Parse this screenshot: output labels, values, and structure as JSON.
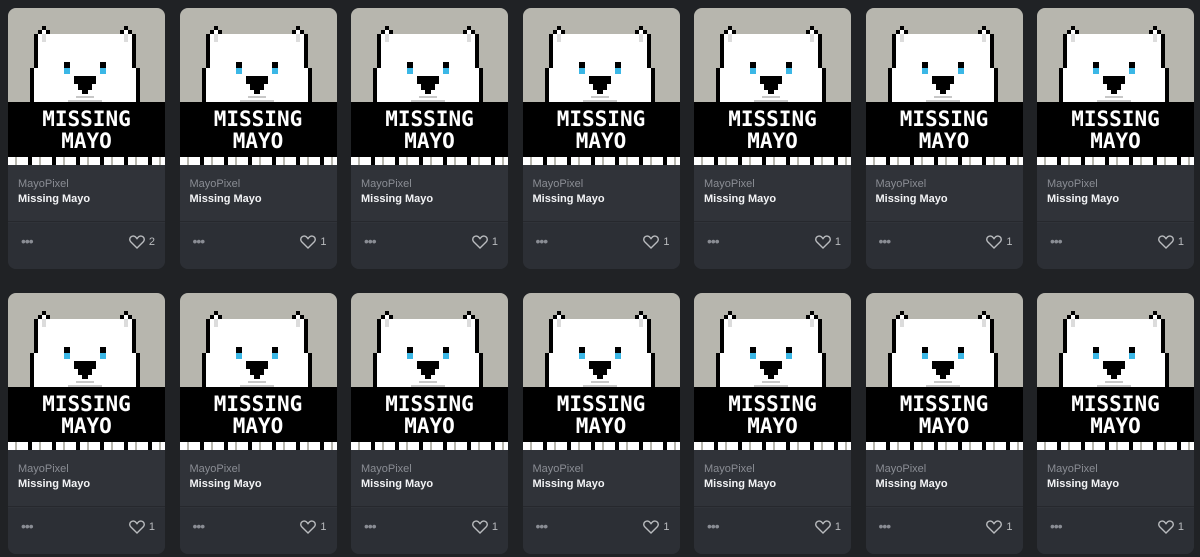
{
  "cards": [
    {
      "collection": "MayoPixel",
      "title": "Missing Mayo",
      "likes": "2",
      "art_line1": "MISSING",
      "art_line2": "MAYO"
    },
    {
      "collection": "MayoPixel",
      "title": "Missing Mayo",
      "likes": "1",
      "art_line1": "MISSING",
      "art_line2": "MAYO"
    },
    {
      "collection": "MayoPixel",
      "title": "Missing Mayo",
      "likes": "1",
      "art_line1": "MISSING",
      "art_line2": "MAYO"
    },
    {
      "collection": "MayoPixel",
      "title": "Missing Mayo",
      "likes": "1",
      "art_line1": "MISSING",
      "art_line2": "MAYO"
    },
    {
      "collection": "MayoPixel",
      "title": "Missing Mayo",
      "likes": "1",
      "art_line1": "MISSING",
      "art_line2": "MAYO"
    },
    {
      "collection": "MayoPixel",
      "title": "Missing Mayo",
      "likes": "1",
      "art_line1": "MISSING",
      "art_line2": "MAYO"
    },
    {
      "collection": "MayoPixel",
      "title": "Missing Mayo",
      "likes": "1",
      "art_line1": "MISSING",
      "art_line2": "MAYO"
    },
    {
      "collection": "MayoPixel",
      "title": "Missing Mayo",
      "likes": "1",
      "art_line1": "MISSING",
      "art_line2": "MAYO"
    },
    {
      "collection": "MayoPixel",
      "title": "Missing Mayo",
      "likes": "1",
      "art_line1": "MISSING",
      "art_line2": "MAYO"
    },
    {
      "collection": "MayoPixel",
      "title": "Missing Mayo",
      "likes": "1",
      "art_line1": "MISSING",
      "art_line2": "MAYO"
    },
    {
      "collection": "MayoPixel",
      "title": "Missing Mayo",
      "likes": "1",
      "art_line1": "MISSING",
      "art_line2": "MAYO"
    },
    {
      "collection": "MayoPixel",
      "title": "Missing Mayo",
      "likes": "1",
      "art_line1": "MISSING",
      "art_line2": "MAYO"
    },
    {
      "collection": "MayoPixel",
      "title": "Missing Mayo",
      "likes": "1",
      "art_line1": "MISSING",
      "art_line2": "MAYO"
    },
    {
      "collection": "MayoPixel",
      "title": "Missing Mayo",
      "likes": "1",
      "art_line1": "MISSING",
      "art_line2": "MAYO"
    }
  ],
  "icons": {
    "more": "more-options-icon",
    "like": "heart-icon"
  },
  "colors": {
    "page_background": "#202225",
    "card_background": "#303339",
    "art_background": "#b7b6ae"
  }
}
